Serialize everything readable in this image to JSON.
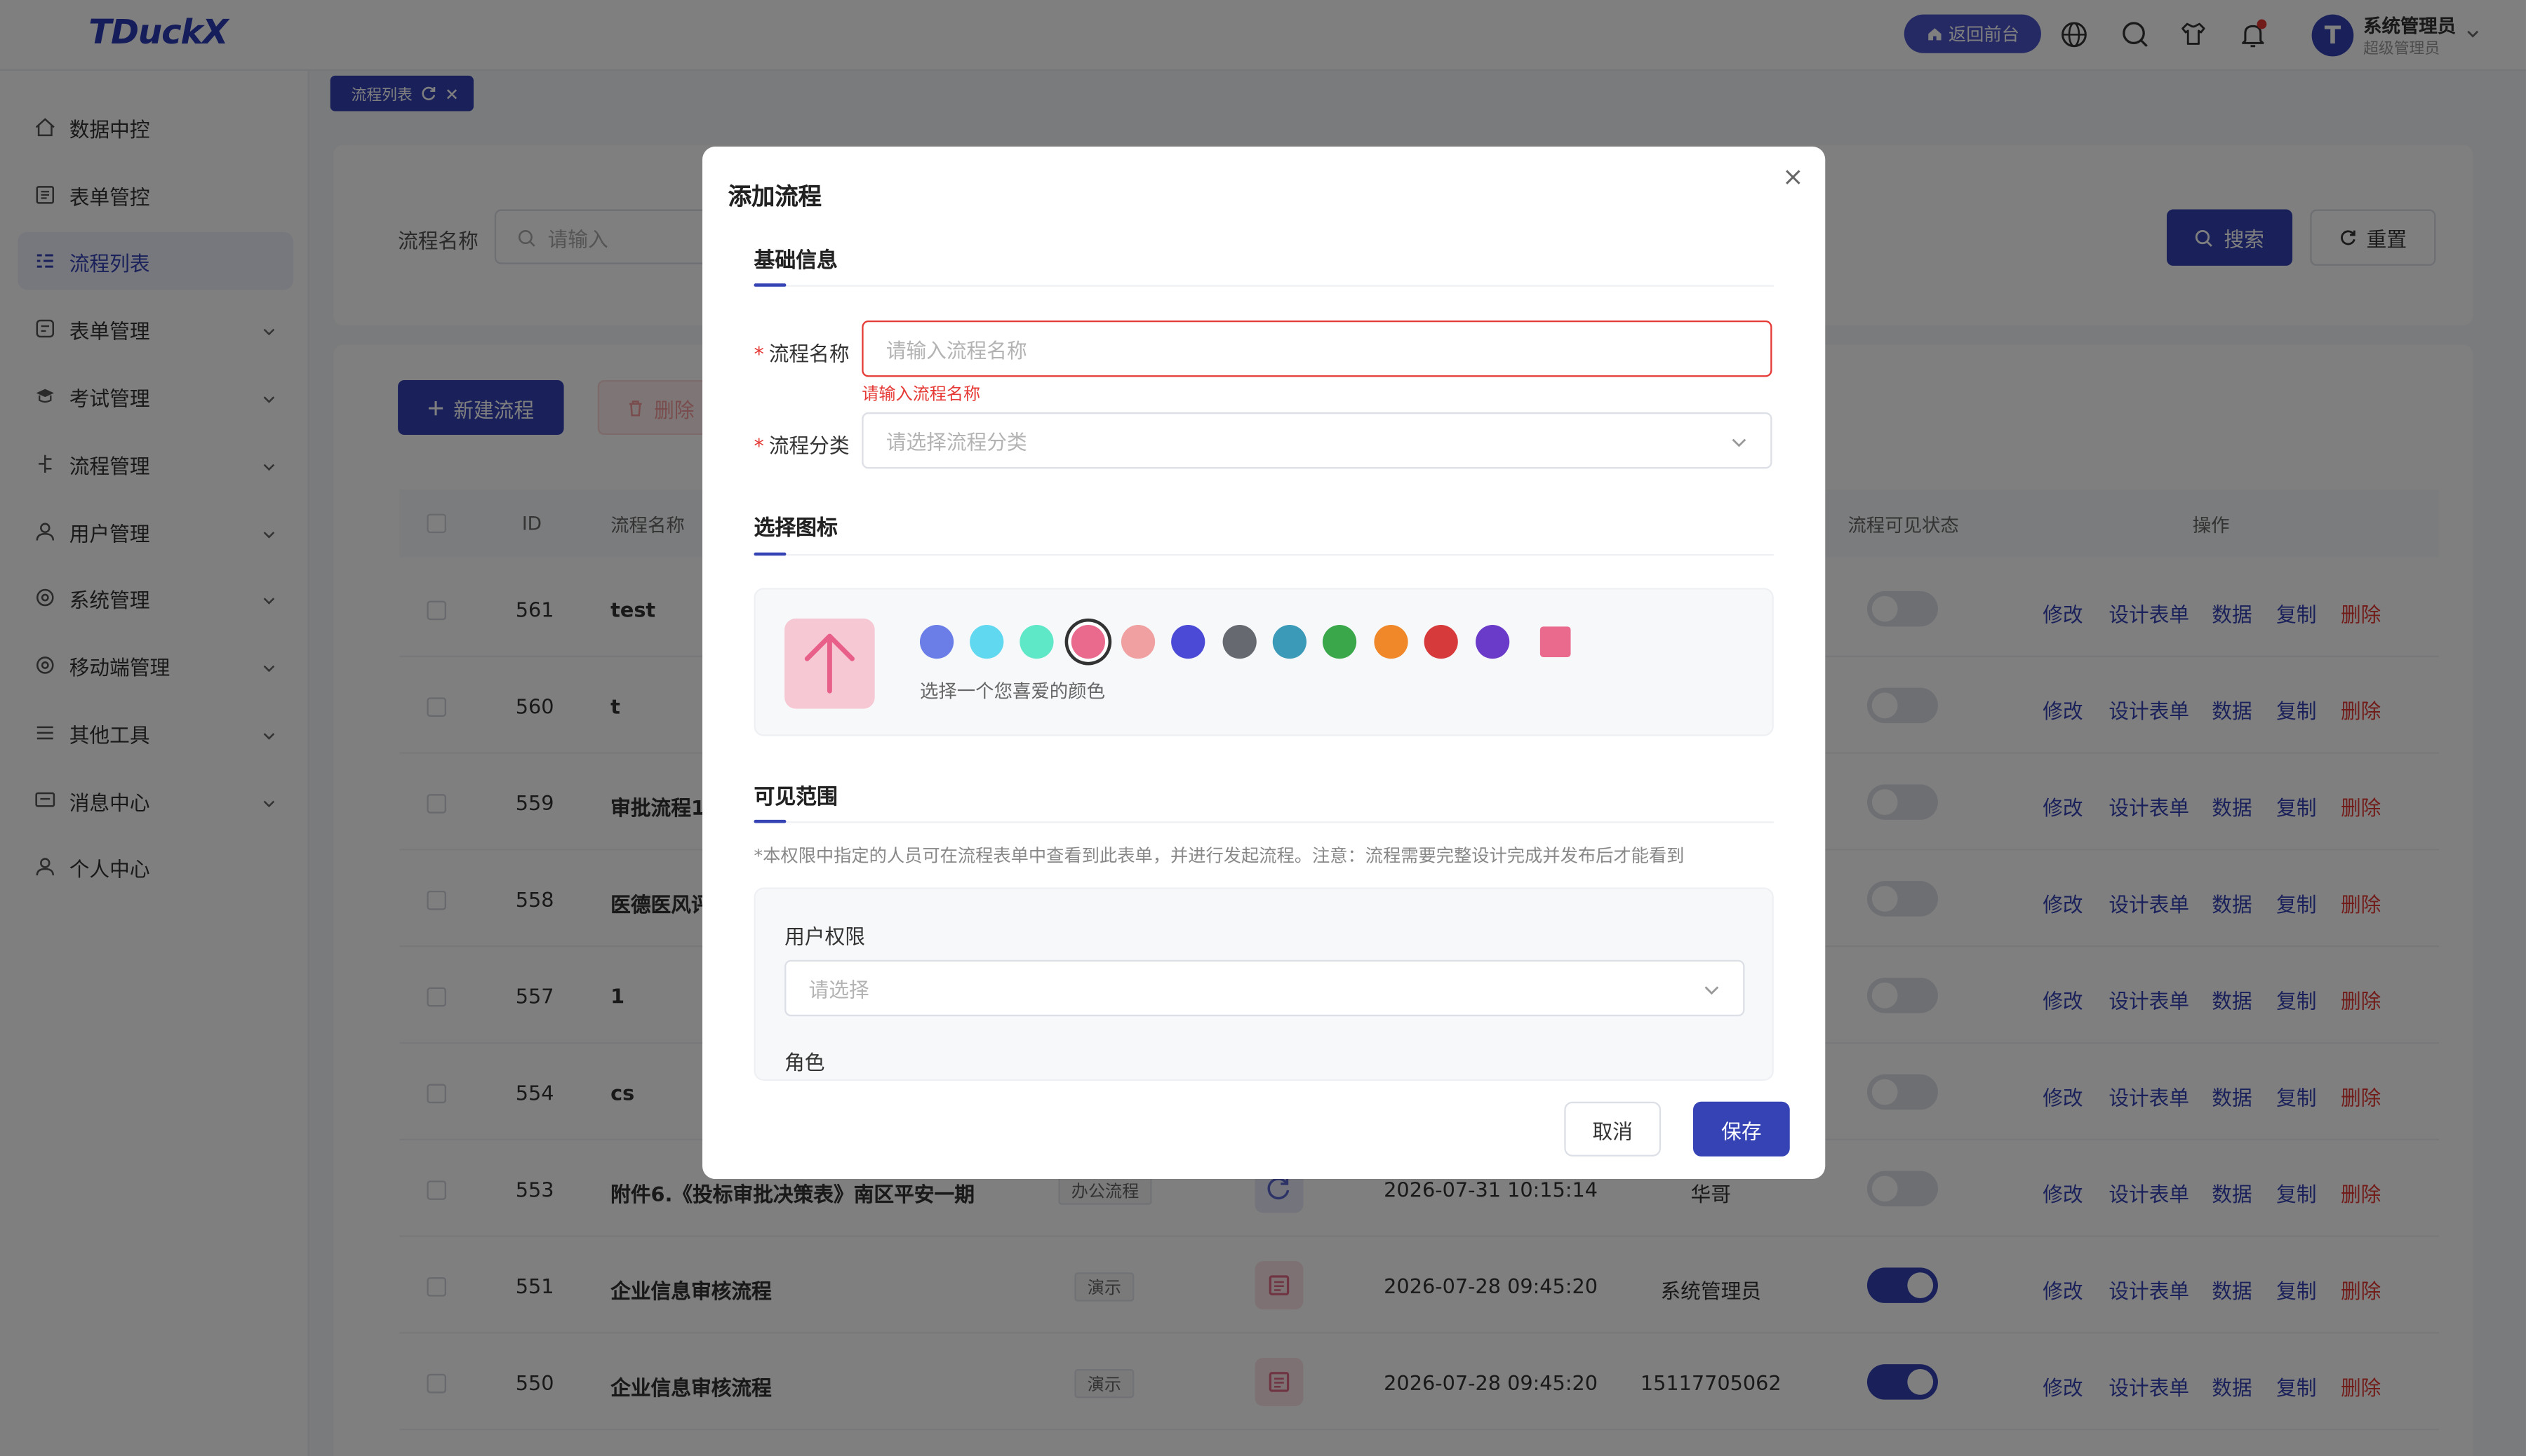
{
  "header": {
    "logo": "TDuckX",
    "back_label": "返回前台",
    "user_name": "系统管理员",
    "user_role": "超级管理员",
    "avatar_letter": "T"
  },
  "sidebar": {
    "items": [
      {
        "label": "数据中控",
        "icon": "home-icon",
        "active": false,
        "expandable": false
      },
      {
        "label": "表单管控",
        "icon": "form-list-icon",
        "active": false,
        "expandable": false
      },
      {
        "label": "流程列表",
        "icon": "flow-list-icon",
        "active": true,
        "expandable": false
      },
      {
        "label": "表单管理",
        "icon": "form-icon",
        "active": false,
        "expandable": true
      },
      {
        "label": "考试管理",
        "icon": "exam-icon",
        "active": false,
        "expandable": true
      },
      {
        "label": "流程管理",
        "icon": "flow-icon",
        "active": false,
        "expandable": true
      },
      {
        "label": "用户管理",
        "icon": "user-icon",
        "active": false,
        "expandable": true
      },
      {
        "label": "系统管理",
        "icon": "gear-icon",
        "active": false,
        "expandable": true
      },
      {
        "label": "移动端管理",
        "icon": "mobile-gear-icon",
        "active": false,
        "expandable": true
      },
      {
        "label": "其他工具",
        "icon": "menu-icon",
        "active": false,
        "expandable": true
      },
      {
        "label": "消息中心",
        "icon": "message-icon",
        "active": false,
        "expandable": true
      },
      {
        "label": "个人中心",
        "icon": "person-icon",
        "active": false,
        "expandable": false
      }
    ]
  },
  "tabs": {
    "active_tab": "流程列表"
  },
  "search": {
    "label": "流程名称",
    "placeholder": "请输入",
    "search_label": "搜索",
    "reset_label": "重置"
  },
  "toolbar": {
    "new_label": "新建流程",
    "delete_label": "删除"
  },
  "table": {
    "columns": [
      "ID",
      "流程名称",
      "流程可见状态",
      "操作"
    ],
    "actions": [
      "修改",
      "设计表单",
      "数据",
      "复制",
      "删除"
    ],
    "rows": [
      {
        "id": "561",
        "name": "test",
        "category": "",
        "updated": "",
        "creator": "",
        "visible": false
      },
      {
        "id": "560",
        "name": "t",
        "category": "",
        "updated": "",
        "creator": "",
        "visible": false
      },
      {
        "id": "559",
        "name": "审批流程1",
        "category": "",
        "updated": "",
        "creator": "",
        "visible": false
      },
      {
        "id": "558",
        "name": "医德医风评",
        "category": "",
        "updated": "",
        "creator": "",
        "visible": false
      },
      {
        "id": "557",
        "name": "1",
        "category": "",
        "updated": "",
        "creator": "",
        "visible": false
      },
      {
        "id": "554",
        "name": "cs",
        "category": "",
        "updated": "",
        "creator": "",
        "visible": false
      },
      {
        "id": "553",
        "name": "附件6.《投标审批决策表》南区平安一期",
        "category": "办公流程",
        "updated": "2026-07-31 10:15:14",
        "creator": "华哥",
        "visible": false
      },
      {
        "id": "551",
        "name": "企业信息审核流程",
        "category": "演示",
        "updated": "2026-07-28 09:45:20",
        "creator": "系统管理员",
        "visible": true
      },
      {
        "id": "550",
        "name": "企业信息审核流程",
        "category": "演示",
        "updated": "2026-07-28 09:45:20",
        "creator": "15117705062",
        "visible": true
      }
    ]
  },
  "modal": {
    "title": "添加流程",
    "sections": {
      "basic": "基础信息",
      "icon": "选择图标",
      "scope": "可见范围"
    },
    "name_label": "流程名称",
    "name_placeholder": "请输入流程名称",
    "name_error": "请输入流程名称",
    "category_label": "流程分类",
    "category_placeholder": "请选择流程分类",
    "color_hint": "选择一个您喜爱的颜色",
    "colors": [
      "#6b7ee8",
      "#5fd8f0",
      "#5ee8c8",
      "#ea6a8e",
      "#f0a0a0",
      "#4a4ad6",
      "#666a70",
      "#3a9ab8",
      "#3aa84a",
      "#f0882a",
      "#d63a3a",
      "#6a3ac8"
    ],
    "selected_color": "#ea6a8e",
    "square_color": "#ea6a8e",
    "scope_note": "*本权限中指定的人员可在流程表单中查看到此表单，并进行发起流程。注意：流程需要完整设计完成并发布后才能看到",
    "user_perm_label": "用户权限",
    "user_perm_placeholder": "请选择",
    "role_label": "角色",
    "cancel_label": "取消",
    "save_label": "保存"
  }
}
